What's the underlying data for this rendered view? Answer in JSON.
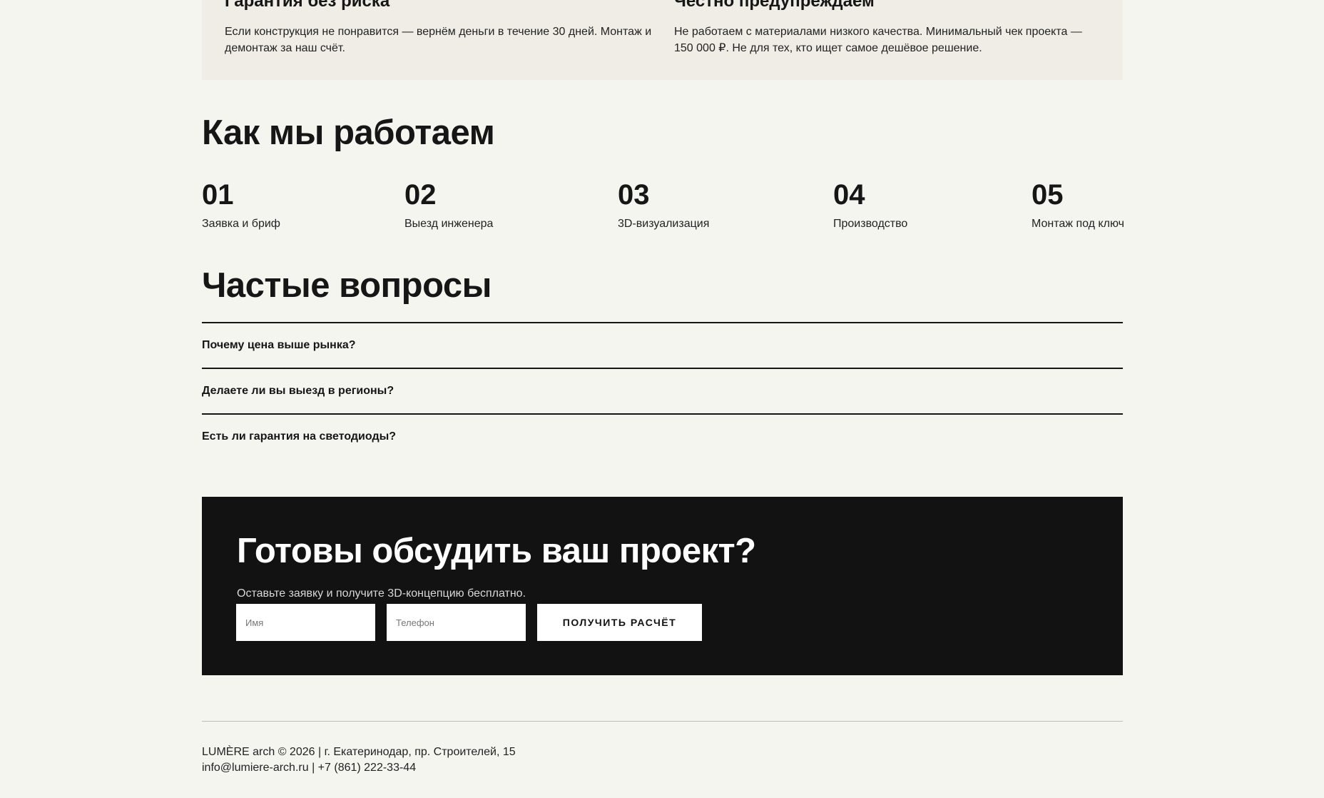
{
  "guarantees": [
    {
      "title": "Гарантия без риска",
      "text": "Если конструкция не понравится — вернём деньги в течение 30 дней. Монтаж и демонтаж за наш счёт."
    },
    {
      "title": "Честно предупреждаем",
      "text": "Не работаем с материалами низкого качества. Минимальный чек проекта — 150 000 ₽. Не для тех, кто ищет самое дешёвое решение."
    }
  ],
  "steps": {
    "title": "Как мы работаем",
    "items": [
      {
        "num": "01",
        "label": "Заявка и бриф"
      },
      {
        "num": "02",
        "label": "Выезд инженера"
      },
      {
        "num": "03",
        "label": "3D-визуализация"
      },
      {
        "num": "04",
        "label": "Производство"
      },
      {
        "num": "05",
        "label": "Монтаж под ключ"
      }
    ]
  },
  "faq": {
    "title": "Частые вопросы",
    "items": [
      {
        "question": "Почему цена выше рынка?"
      },
      {
        "question": "Делаете ли вы выезд в регионы?"
      },
      {
        "question": "Есть ли гарантия на светодиоды?"
      }
    ]
  },
  "cta": {
    "title": "Готовы обсудить ваш проект?",
    "subtitle": "Оставьте заявку и получите 3D-концепцию бесплатно.",
    "name_placeholder": "Имя",
    "phone_placeholder": "Телефон",
    "button_label": "ПОЛУЧИТЬ РАСЧЁТ"
  },
  "footer": {
    "line1": "LUMÈRE arch © 2026 | г. Екатеринодар, пр. Строителей, 15",
    "email": "info@lumiere-arch.ru",
    "separator": " | ",
    "phone": "+7 (861) 222-33-44"
  },
  "colors": {
    "page_background": "#f5f5f0",
    "panel_background": "#efede6",
    "cta_background": "#121212",
    "text": "#161616"
  }
}
